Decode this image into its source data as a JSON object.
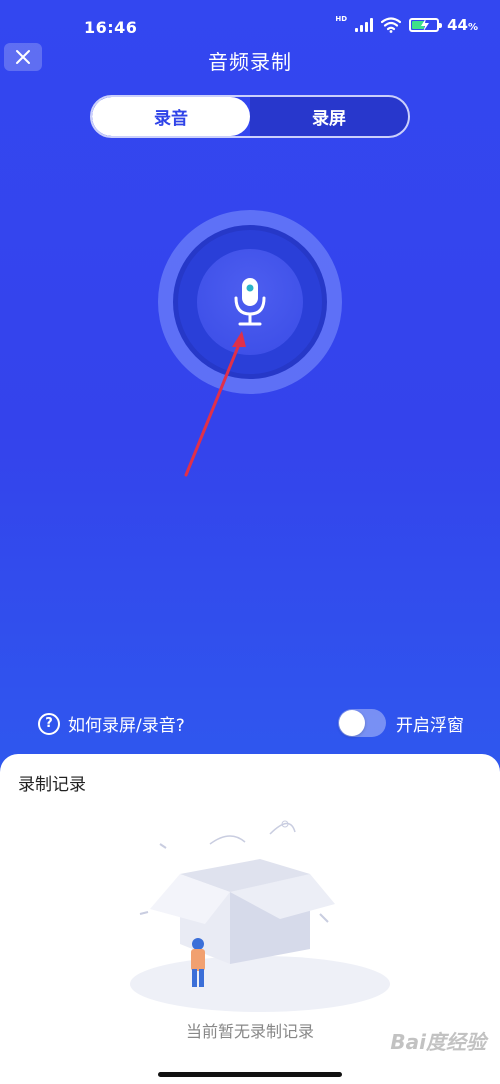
{
  "status_bar": {
    "time": "16:46",
    "network_badge": "HD",
    "battery_percent": "44",
    "battery_unit": "%",
    "icons": [
      "signal-icon",
      "wifi-icon",
      "battery-charging-icon"
    ]
  },
  "header": {
    "title": "音频录制",
    "close_icon": "close-icon"
  },
  "mode_switch": {
    "options": [
      {
        "label": "录音",
        "selected": true
      },
      {
        "label": "录屏",
        "selected": false
      }
    ]
  },
  "record_button": {
    "icon": "microphone-icon"
  },
  "footer_controls": {
    "help_label": "如何录屏/录音?",
    "help_icon": "question-icon",
    "float_label": "开启浮窗",
    "float_enabled": false
  },
  "records": {
    "title": "录制记录",
    "empty_text": "当前暂无录制记录"
  },
  "watermark": "Bai度经验",
  "colors": {
    "background": "#3347f0",
    "accent": "#2f43e8",
    "annotation_arrow": "#e0304a"
  }
}
